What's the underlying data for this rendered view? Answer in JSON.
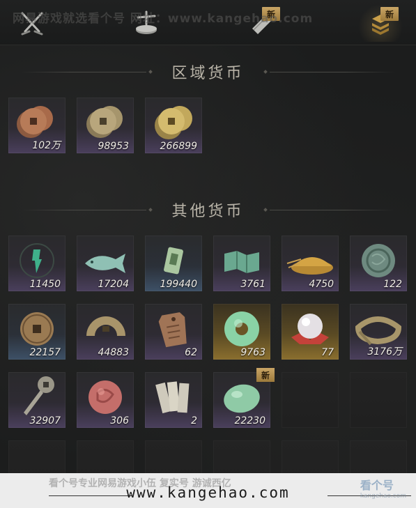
{
  "watermark_top": "网易游戏就选看个号  网址：www.kangehao.com",
  "tabs": [
    {
      "name": "tab-combat",
      "icon": "crossed-swords-icon",
      "new": false,
      "active": false
    },
    {
      "name": "tab-balance",
      "icon": "scale-icon",
      "new": false,
      "active": false
    },
    {
      "name": "tab-scroll",
      "icon": "scroll-icon",
      "new": true,
      "active": false
    },
    {
      "name": "tab-currency",
      "icon": "coin-stack-icon",
      "new": true,
      "active": true
    }
  ],
  "new_label": "新",
  "sections": {
    "regional": "区域货币",
    "other": "其他货币"
  },
  "regional_items": [
    {
      "icon": "copper-coins-icon",
      "qty": "102万",
      "tone": "purple"
    },
    {
      "icon": "brass-coins-icon",
      "qty": "98953",
      "tone": "purple"
    },
    {
      "icon": "gold-coins-icon",
      "qty": "266899",
      "tone": "purple"
    }
  ],
  "other_items": [
    {
      "icon": "jade-sigil-icon",
      "qty": "11450",
      "tone": "purple"
    },
    {
      "icon": "jade-fish-icon",
      "qty": "17204",
      "tone": "purple"
    },
    {
      "icon": "jade-token-icon",
      "qty": "199440",
      "tone": "blue"
    },
    {
      "icon": "jade-map-icon",
      "qty": "3761",
      "tone": "purple"
    },
    {
      "icon": "grain-pile-icon",
      "qty": "4750",
      "tone": "purple"
    },
    {
      "icon": "carved-jade-disc-icon",
      "qty": "122",
      "tone": "purple"
    },
    {
      "icon": "ancient-coin-icon",
      "qty": "22157",
      "tone": "blue"
    },
    {
      "icon": "half-coin-icon",
      "qty": "44883",
      "tone": "purple"
    },
    {
      "icon": "bronze-tablet-icon",
      "qty": "62",
      "tone": "purple"
    },
    {
      "icon": "jade-ring-icon",
      "qty": "9763",
      "tone": "gold"
    },
    {
      "icon": "pearl-icon",
      "qty": "77",
      "tone": "gold"
    },
    {
      "icon": "coin-string-icon",
      "qty": "3176万",
      "tone": "purple"
    },
    {
      "icon": "key-coin-icon",
      "qty": "32907",
      "tone": "purple"
    },
    {
      "icon": "red-jade-disc-icon",
      "qty": "306",
      "tone": "purple"
    },
    {
      "icon": "paper-notes-icon",
      "qty": "2",
      "tone": "purple"
    },
    {
      "icon": "green-jade-stone-icon",
      "qty": "22230",
      "tone": "purple",
      "new": true
    }
  ],
  "banner": {
    "cn_text": "看个号专业网易游戏小伍 复实号 游诚西亿",
    "url": "www.kangehao.com",
    "logo": "看个号",
    "logo_sub": "kangehao.com"
  }
}
